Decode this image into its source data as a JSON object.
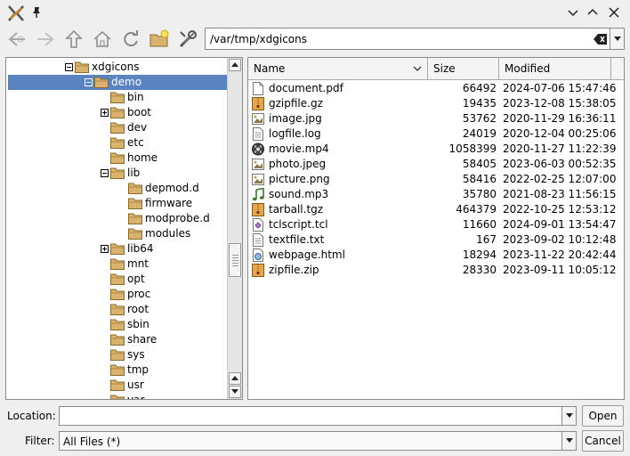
{
  "window": {
    "app_icon": "xdg-tools-icon",
    "pin_icon": "pin-icon"
  },
  "toolbar": {
    "buttons": [
      "back-icon",
      "forward-icon",
      "up-icon",
      "home-icon",
      "reload-icon",
      "new-folder-icon",
      "settings-icon"
    ],
    "path": "/var/tmp/xdgicons"
  },
  "tree": {
    "items": [
      {
        "label": "xdgicons",
        "depth": 0,
        "expander": "minus"
      },
      {
        "label": "demo",
        "depth": 1,
        "expander": "minus",
        "selected": true
      },
      {
        "label": "bin",
        "depth": 2,
        "expander": ""
      },
      {
        "label": "boot",
        "depth": 2,
        "expander": "plus"
      },
      {
        "label": "dev",
        "depth": 2,
        "expander": ""
      },
      {
        "label": "etc",
        "depth": 2,
        "expander": ""
      },
      {
        "label": "home",
        "depth": 2,
        "expander": ""
      },
      {
        "label": "lib",
        "depth": 2,
        "expander": "minus"
      },
      {
        "label": "depmod.d",
        "depth": 3,
        "expander": ""
      },
      {
        "label": "firmware",
        "depth": 3,
        "expander": ""
      },
      {
        "label": "modprobe.d",
        "depth": 3,
        "expander": ""
      },
      {
        "label": "modules",
        "depth": 3,
        "expander": ""
      },
      {
        "label": "lib64",
        "depth": 2,
        "expander": "plus"
      },
      {
        "label": "mnt",
        "depth": 2,
        "expander": ""
      },
      {
        "label": "opt",
        "depth": 2,
        "expander": ""
      },
      {
        "label": "proc",
        "depth": 2,
        "expander": ""
      },
      {
        "label": "root",
        "depth": 2,
        "expander": ""
      },
      {
        "label": "sbin",
        "depth": 2,
        "expander": ""
      },
      {
        "label": "share",
        "depth": 2,
        "expander": ""
      },
      {
        "label": "sys",
        "depth": 2,
        "expander": ""
      },
      {
        "label": "tmp",
        "depth": 2,
        "expander": ""
      },
      {
        "label": "usr",
        "depth": 2,
        "expander": ""
      },
      {
        "label": "var",
        "depth": 2,
        "expander": ""
      }
    ]
  },
  "files": {
    "columns": {
      "name": "Name",
      "size": "Size",
      "modified": "Modified"
    },
    "rows": [
      {
        "name": "document.pdf",
        "size": "66492",
        "modified": "2024-07-06 15:47:46",
        "icon": "document-icon"
      },
      {
        "name": "gzipfile.gz",
        "size": "19435",
        "modified": "2023-12-08 15:38:05",
        "icon": "archive-icon"
      },
      {
        "name": "image.jpg",
        "size": "53762",
        "modified": "2020-11-29 16:36:11",
        "icon": "image-icon"
      },
      {
        "name": "logfile.log",
        "size": "24019",
        "modified": "2020-12-04 00:25:06",
        "icon": "text-file-icon"
      },
      {
        "name": "movie.mp4",
        "size": "1058399",
        "modified": "2020-11-27 11:22:39",
        "icon": "video-icon"
      },
      {
        "name": "photo.jpeg",
        "size": "58405",
        "modified": "2023-06-03 00:52:35",
        "icon": "image-icon"
      },
      {
        "name": "picture.png",
        "size": "58416",
        "modified": "2022-02-25 12:07:00",
        "icon": "image-icon"
      },
      {
        "name": "sound.mp3",
        "size": "35780",
        "modified": "2021-08-23 11:56:15",
        "icon": "audio-icon"
      },
      {
        "name": "tarball.tgz",
        "size": "464379",
        "modified": "2022-10-25 12:53:12",
        "icon": "archive-icon"
      },
      {
        "name": "tclscript.tcl",
        "size": "11660",
        "modified": "2024-09-01 13:54:47",
        "icon": "script-icon"
      },
      {
        "name": "textfile.txt",
        "size": "167",
        "modified": "2023-09-02 10:12:48",
        "icon": "text-file-icon"
      },
      {
        "name": "webpage.html",
        "size": "18294",
        "modified": "2023-11-22 20:42:44",
        "icon": "html-icon"
      },
      {
        "name": "zipfile.zip",
        "size": "28330",
        "modified": "2023-09-11 10:05:12",
        "icon": "archive-icon"
      }
    ]
  },
  "location": {
    "label": "Location:",
    "value": "",
    "button": "Open"
  },
  "filter": {
    "label": "Filter:",
    "value": "All Files (*)",
    "button": "Cancel"
  },
  "colors": {
    "selection": "#5a84c1",
    "folder": "#d9b36c",
    "archive": "#e8a64a"
  }
}
